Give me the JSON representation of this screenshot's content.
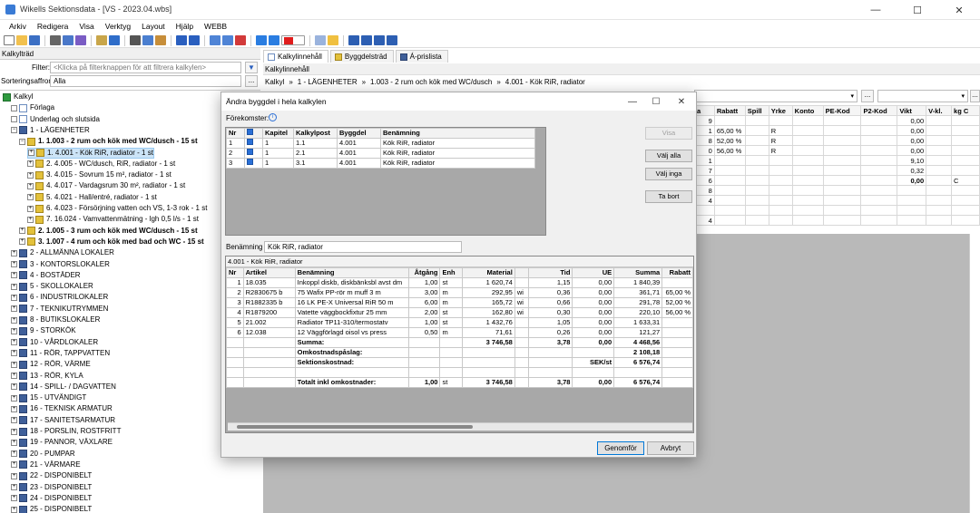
{
  "window": {
    "title": "Wikells Sektionsdata - [VS - 2023.04.wbs]",
    "minimize": "—",
    "maximize": "☐",
    "close": "✕"
  },
  "menu": [
    "Arkiv",
    "Redigera",
    "Visa",
    "Verktyg",
    "Layout",
    "Hjälp",
    "WEBB"
  ],
  "left": {
    "header": "Kalkylträd",
    "filter_label": "Filter:",
    "filter_placeholder": "<Klicka på filterknappen för att filtrera kalkylen>",
    "sort_label": "Sorteringsaffror:",
    "sort_value": "Alla",
    "sort_btn": "...",
    "tree": [
      {
        "label": "Kalkyl",
        "level": 0,
        "icon": "green",
        "exp": ""
      },
      {
        "label": "Förlaga",
        "level": 1,
        "icon": "doc",
        "exp": ""
      },
      {
        "label": "Underlag och slutsida",
        "level": 1,
        "icon": "doc",
        "exp": ""
      },
      {
        "label": "1 - LÄGENHETER",
        "level": 1,
        "icon": "book",
        "exp": "−"
      },
      {
        "label": "1. 1.003 - 2 rum och kök med WC/dusch - 15 st",
        "level": 2,
        "icon": "gold",
        "exp": "−",
        "bold": true
      },
      {
        "label": "1. 4.001 - Kök RiR, radiator - 1 st",
        "level": 3,
        "icon": "gold",
        "exp": "+",
        "selected": true
      },
      {
        "label": "2. 4.005 - WC/dusch, RiR, radiator - 1 st",
        "level": 3,
        "icon": "gold",
        "exp": "+"
      },
      {
        "label": "3. 4.015 - Sovrum 15 m², radiator - 1 st",
        "level": 3,
        "icon": "gold",
        "exp": "+"
      },
      {
        "label": "4. 4.017 - Vardagsrum 30 m², radiator - 1 st",
        "level": 3,
        "icon": "gold",
        "exp": "+"
      },
      {
        "label": "5. 4.021 - Hall/entré, radiator - 1 st",
        "level": 3,
        "icon": "gold",
        "exp": "+"
      },
      {
        "label": "6. 4.023 - Försörjning vatten och VS, 1-3 rok - 1 st",
        "level": 3,
        "icon": "gold",
        "exp": "+"
      },
      {
        "label": "7. 16.024 - Vamvattenmätning - lgh 0,5 l/s - 1 st",
        "level": 3,
        "icon": "gold",
        "exp": "+"
      },
      {
        "label": "2. 1.005 - 3 rum och kök med WC/dusch - 15 st",
        "level": 2,
        "icon": "gold",
        "exp": "+",
        "bold": true
      },
      {
        "label": "3. 1.007 - 4 rum och kök med bad och WC - 15 st",
        "level": 2,
        "icon": "gold",
        "exp": "+",
        "bold": true
      },
      {
        "label": "2 - ALLMÄNNA LOKALER",
        "level": 1,
        "icon": "book",
        "exp": "+"
      },
      {
        "label": "3 - KONTORSLOKALER",
        "level": 1,
        "icon": "book",
        "exp": "+"
      },
      {
        "label": "4 - BOSTÄDER",
        "level": 1,
        "icon": "book",
        "exp": "+"
      },
      {
        "label": "5 - SKOLLOKALER",
        "level": 1,
        "icon": "book",
        "exp": "+"
      },
      {
        "label": "6 - INDUSTRILOKALER",
        "level": 1,
        "icon": "book",
        "exp": "+"
      },
      {
        "label": "7 - TEKNIKUTRYMMEN",
        "level": 1,
        "icon": "book",
        "exp": "+"
      },
      {
        "label": "8 - BUTIKSLOKALER",
        "level": 1,
        "icon": "book",
        "exp": "+"
      },
      {
        "label": "9 - STORKÖK",
        "level": 1,
        "icon": "book",
        "exp": "+"
      },
      {
        "label": "10 - VÅRDLOKALER",
        "level": 1,
        "icon": "book",
        "exp": "+"
      },
      {
        "label": "11 - RÖR, TAPPVATTEN",
        "level": 1,
        "icon": "book",
        "exp": "+"
      },
      {
        "label": "12 - RÖR, VÄRME",
        "level": 1,
        "icon": "book",
        "exp": "+"
      },
      {
        "label": "13 - RÖR, KYLA",
        "level": 1,
        "icon": "book",
        "exp": "+"
      },
      {
        "label": "14 - SPILL- / DAGVATTEN",
        "level": 1,
        "icon": "book",
        "exp": "+"
      },
      {
        "label": "15 - UTVÄNDIGT",
        "level": 1,
        "icon": "book",
        "exp": "+"
      },
      {
        "label": "16 - TEKNISK ARMATUR",
        "level": 1,
        "icon": "book",
        "exp": "+"
      },
      {
        "label": "17 - SANITETSARMATUR",
        "level": 1,
        "icon": "book",
        "exp": "+"
      },
      {
        "label": "18 - PORSLIN, ROSTFRITT",
        "level": 1,
        "icon": "book",
        "exp": "+"
      },
      {
        "label": "19 - PANNOR, VÄXLARE",
        "level": 1,
        "icon": "book",
        "exp": "+"
      },
      {
        "label": "20 - PUMPAR",
        "level": 1,
        "icon": "book",
        "exp": "+"
      },
      {
        "label": "21 - VÄRMARE",
        "level": 1,
        "icon": "book",
        "exp": "+"
      },
      {
        "label": "22 - DISPONIBELT",
        "level": 1,
        "icon": "book",
        "exp": "+"
      },
      {
        "label": "23 - DISPONIBELT",
        "level": 1,
        "icon": "book",
        "exp": "+"
      },
      {
        "label": "24 - DISPONIBELT",
        "level": 1,
        "icon": "book",
        "exp": "+"
      },
      {
        "label": "25 - DISPONIBELT",
        "level": 1,
        "icon": "book",
        "exp": "+"
      }
    ]
  },
  "right": {
    "tabs": [
      "Kalkylinnehåll",
      "Byggdelsträd",
      "Á-prislista"
    ],
    "header": "Kalkylinnehåll",
    "breadcrumb": [
      "Kalkyl",
      "»",
      "1 - LÄGENHETER",
      "»",
      "1.003 - 2 rum och kök med WC/dusch",
      "»",
      "4.001 - Kök RiR, radiator"
    ],
    "combo_btn": "...",
    "bg_headers": [
      "a",
      "Rabatt",
      "Spill",
      "Yrke",
      "Konto",
      "PE-Kod",
      "P2-Kod",
      "Vikt",
      "V-kl.",
      "kg C"
    ],
    "bg_rows": [
      [
        "9",
        "",
        "",
        "",
        "",
        "",
        "",
        "0,00",
        "",
        ""
      ],
      [
        "1",
        "65,00 %",
        "",
        "R",
        "",
        "",
        "",
        "0,00",
        "",
        ""
      ],
      [
        "8",
        "52,00 %",
        "",
        "R",
        "",
        "",
        "",
        "0,00",
        "",
        ""
      ],
      [
        "0",
        "56,00 %",
        "",
        "R",
        "",
        "",
        "",
        "0,00",
        "",
        ""
      ],
      [
        "1",
        "",
        "",
        "",
        "",
        "",
        "",
        "9,10",
        "",
        ""
      ],
      [
        "7",
        "",
        "",
        "",
        "",
        "",
        "",
        "0,32",
        "",
        ""
      ],
      [
        "6",
        "",
        "",
        "",
        "",
        "",
        "",
        "0,00",
        "",
        "C"
      ],
      [
        "8",
        "",
        "",
        "",
        "",
        "",
        "",
        "",
        "",
        ""
      ],
      [
        "4",
        "",
        "",
        "",
        "",
        "",
        "",
        "",
        "",
        ""
      ],
      [
        "",
        "",
        "",
        "",
        "",
        "",
        "",
        "",
        "",
        ""
      ],
      [
        "4",
        "",
        "",
        "",
        "",
        "",
        "",
        "",
        "",
        ""
      ]
    ]
  },
  "dialog": {
    "title": "Ändra byggdel i hela kalkylen",
    "occurrences_label": "Förekomster:",
    "info_icon": "i",
    "grid1_headers": [
      "Nr",
      "",
      "Kapitel",
      "Kalkylpost",
      "Byggdel",
      "Benämning"
    ],
    "grid1_rows": [
      [
        "1",
        "",
        "1",
        "1.1",
        "4.001",
        "Kök RiR, radiator"
      ],
      [
        "2",
        "",
        "1",
        "2.1",
        "4.001",
        "Kök RiR, radiator"
      ],
      [
        "3",
        "",
        "1",
        "3.1",
        "4.001",
        "Kök RiR, radiator"
      ]
    ],
    "btn_show": "Visa",
    "btn_select_all": "Välj alla",
    "btn_select_none": "Välj inga",
    "btn_remove": "Ta bort",
    "name_label": "Benämning",
    "name_value": "Kök RiR, radiator",
    "grid2_title": "4.001 - Kök RiR, radiator",
    "grid2_headers": [
      "Nr",
      "Artikel",
      "Benämning",
      "Åtgång",
      "Enh",
      "Material",
      "",
      "Tid",
      "UE",
      "Summa",
      "Rabatt"
    ],
    "grid2_rows": [
      [
        "1",
        "18.035",
        "Inkoppl diskb, diskbänksbl avst dm",
        "1,00",
        "st",
        "1 620,74",
        "",
        "1,15",
        "0,00",
        "1 840,39",
        ""
      ],
      [
        "2",
        "R2830675 b",
        "75 Wafix PP-rör m muff 3 m",
        "3,00",
        "m",
        "292,95",
        "wi",
        "0,36",
        "0,00",
        "361,71",
        "65,00 %"
      ],
      [
        "3",
        "R1882335 b",
        "16 LK PE-X Universal RiR 50 m",
        "6,00",
        "m",
        "165,72",
        "wi",
        "0,66",
        "0,00",
        "291,78",
        "52,00 %"
      ],
      [
        "4",
        "R1879200",
        "Vatette väggbockfixtur 25 mm",
        "2,00",
        "st",
        "162,80",
        "wi",
        "0,30",
        "0,00",
        "220,10",
        "56,00 %"
      ],
      [
        "5",
        "21.002",
        "Radiator TP11-310/termostatv",
        "1,00",
        "st",
        "1 432,76",
        "",
        "1,05",
        "0,00",
        "1 633,31",
        ""
      ],
      [
        "6",
        "12.038",
        "12 Väggförlagd oisol vs press",
        "0,50",
        "m",
        "71,61",
        "",
        "0,26",
        "0,00",
        "121,27",
        ""
      ]
    ],
    "sum_label": "Summa:",
    "sum_material": "3 746,58",
    "sum_tid": "3,78",
    "sum_ue": "0,00",
    "sum_summa": "4 468,56",
    "overhead_label": "Omkostnadspåslag:",
    "overhead_value": "2 108,18",
    "section_label": "Sektionskostnad:",
    "section_unit": "SEK/st",
    "section_value": "6 576,74",
    "total_label": "Totalt inkl omkostnader:",
    "total_qty": "1,00",
    "total_unit": "st",
    "total_material": "3 746,58",
    "total_tid": "3,78",
    "total_ue": "0,00",
    "total_summa": "6 576,74",
    "btn_apply": "Genomför",
    "btn_cancel": "Avbryt"
  }
}
